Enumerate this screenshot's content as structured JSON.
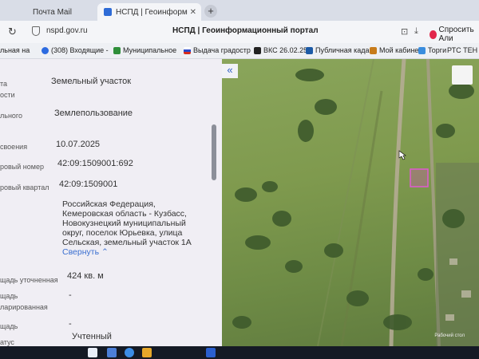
{
  "browser": {
    "tabs": [
      {
        "label": "Почта Mail",
        "active": false
      },
      {
        "label": "НСПД | Геоинформ",
        "active": true
      }
    ],
    "address": {
      "url": "nspd.gov.ru",
      "page_title": "НСПД | Геоинформационный портал",
      "alice_label": "Спросить Али"
    },
    "bookmarks": [
      {
        "label": "льная на"
      },
      {
        "label": "(308) Входящие -"
      },
      {
        "label": "Муниципальное"
      },
      {
        "label": "Выдача градостр"
      },
      {
        "label": "ВКС 26.02.25"
      },
      {
        "label": "Публичная када"
      },
      {
        "label": "Мой кабинет"
      },
      {
        "label": "Торги"
      },
      {
        "label": "РТС ТЕН"
      }
    ]
  },
  "info_panel": {
    "rows": [
      {
        "label": "та",
        "value": "Земельный участок"
      },
      {
        "label": "ости",
        "value": ""
      },
      {
        "label": "льного",
        "value": "Землепользование"
      },
      {
        "label": "своения",
        "value": "10.07.2025"
      },
      {
        "label": "ровый номер",
        "value": "42:09:1509001:692"
      },
      {
        "label": "ровый квартал",
        "value": "42:09:1509001"
      },
      {
        "label": "щадь уточненная",
        "value": "424 кв. м"
      },
      {
        "label": "щадь",
        "value": "-"
      },
      {
        "label": "ларированная",
        "value": ""
      },
      {
        "label": "щадь",
        "value": "-"
      },
      {
        "label": "атус",
        "value": "Учтенный"
      }
    ],
    "address_lines": [
      "Российская Федерация,",
      "Кемеровская область - Кузбасс,",
      "Новокузнецкий муниципальный",
      "округ, поселок Юрьевка, улица",
      "Сельская, земельный участок 1А"
    ],
    "address_more": "Свернуть"
  },
  "map": {
    "collapse_glyph": "«",
    "scale_label": "Рабочий стол"
  }
}
